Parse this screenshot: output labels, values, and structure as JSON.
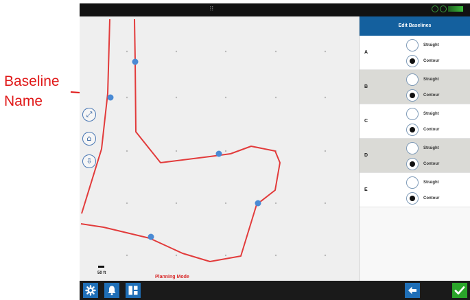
{
  "annotation": {
    "label_line1": "Baseline",
    "label_line2": "Name"
  },
  "map": {
    "scale_label": "50 ft",
    "mode_label": "Planning Mode",
    "controls": [
      "zoom-extents-icon",
      "home-icon",
      "vehicle-position-icon"
    ]
  },
  "panel": {
    "title": "Edit Baselines",
    "rows": [
      {
        "letter": "A",
        "opt1": "Straight",
        "opt2": "Contour",
        "selected": "Contour"
      },
      {
        "letter": "B",
        "opt1": "Straight",
        "opt2": "Contour",
        "selected": "Contour"
      },
      {
        "letter": "C",
        "opt1": "Straight",
        "opt2": "Contour",
        "selected": "Contour"
      },
      {
        "letter": "D",
        "opt1": "Straight",
        "opt2": "Contour",
        "selected": "Contour"
      },
      {
        "letter": "E",
        "opt1": "Straight",
        "opt2": "Contour",
        "selected": "Contour"
      }
    ]
  },
  "bottombar": {
    "buttons": [
      "settings-icon",
      "alerts-bell-icon",
      "layout-icon",
      "back-arrow-icon",
      "confirm-check-icon"
    ]
  },
  "colors": {
    "accent": "#14609e",
    "baseline_line": "#e23b3b",
    "baseline_point": "#4a8ad4",
    "confirm": "#2aa52a",
    "callout": "#e01818"
  }
}
